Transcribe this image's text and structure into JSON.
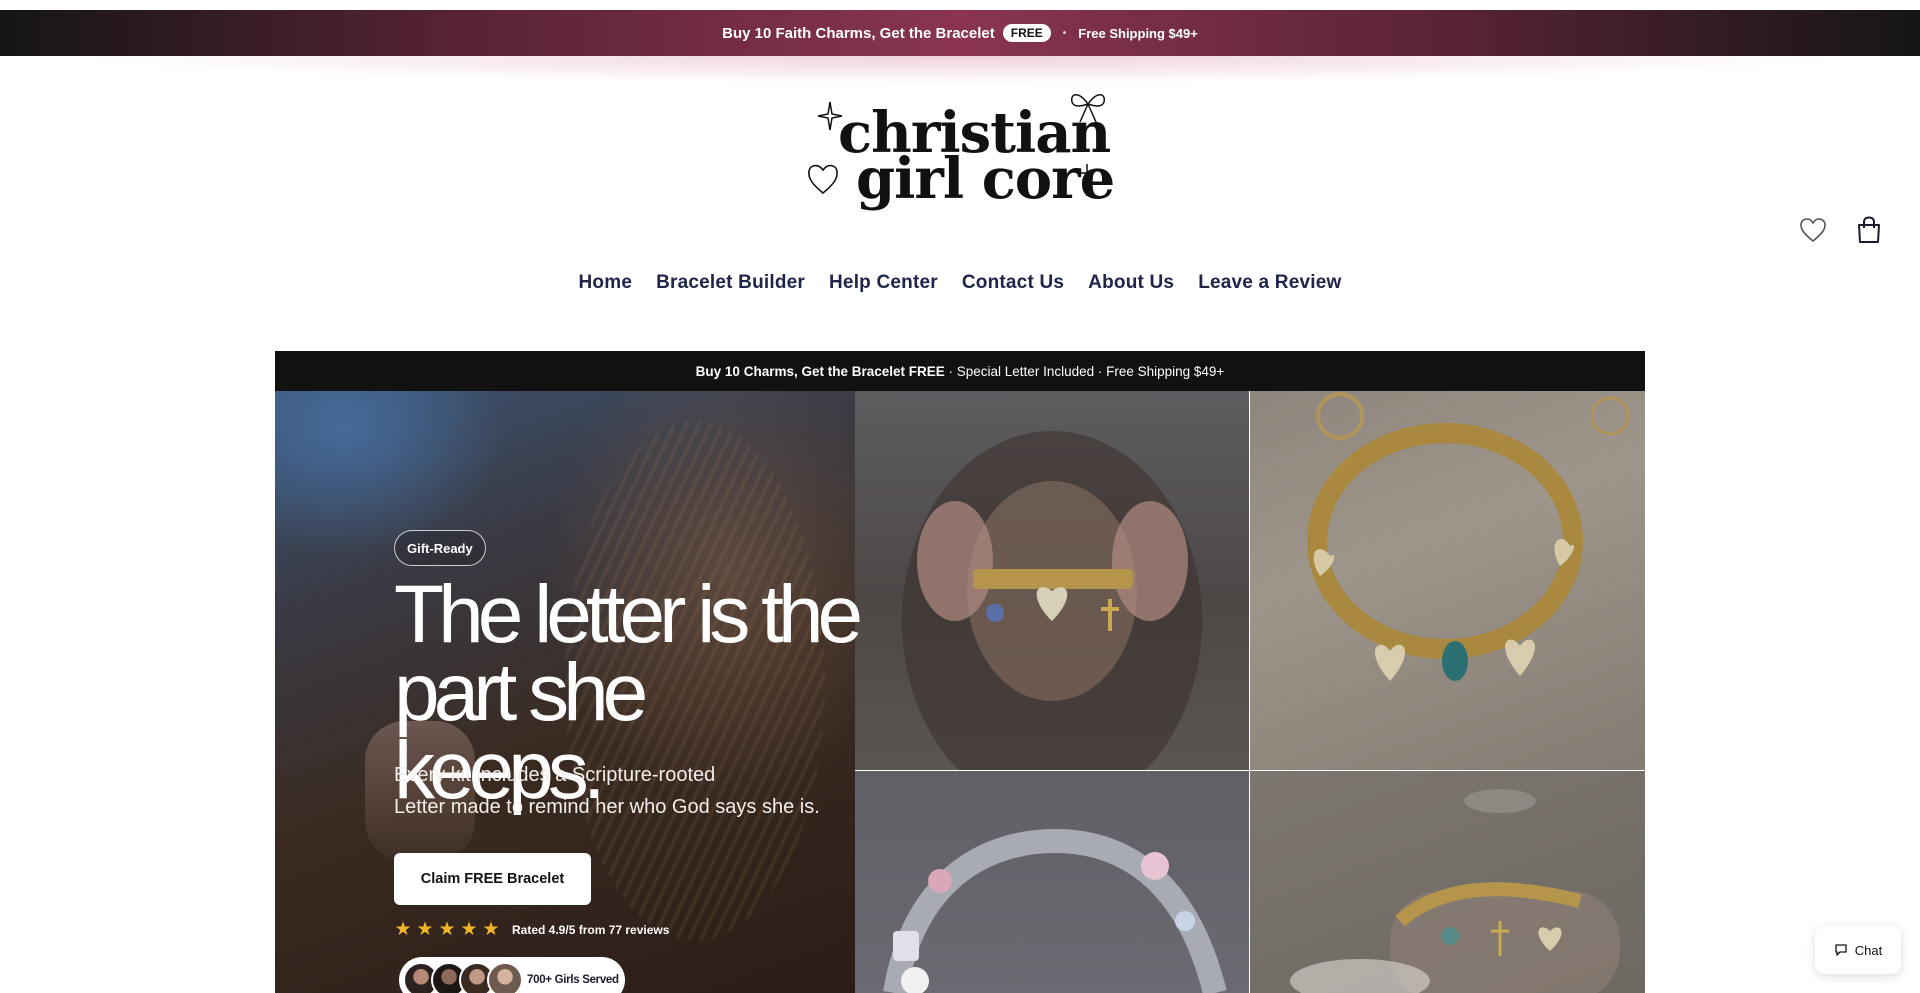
{
  "announcement": {
    "main_text": "Buy 10 Faith Charms, Get the Bracelet",
    "badge": "FREE",
    "separator": "•",
    "shipping": "Free Shipping $49+"
  },
  "logo": {
    "line1": "christian",
    "line2": "girl core"
  },
  "header_icons": {
    "wishlist": "heart-icon",
    "cart": "shopping-bag-icon"
  },
  "nav": {
    "items": [
      {
        "label": "Home"
      },
      {
        "label": "Bracelet Builder"
      },
      {
        "label": "Help Center"
      },
      {
        "label": "Contact Us"
      },
      {
        "label": "About Us"
      },
      {
        "label": "Leave a Review"
      }
    ]
  },
  "hero": {
    "bar": {
      "bold": "Buy 10 Charms, Get the Bracelet FREE",
      "rest": " · Special Letter Included · Free Shipping $49+"
    },
    "badge": "Gift-Ready",
    "headline_line1": "The letter is the",
    "headline_line2": "part she keeps.",
    "sub_line1": "Every kit includes a Scripture-rooted",
    "sub_line2": "Letter made to remind her who God says she is.",
    "cta": "Claim FREE Bracelet",
    "rating_stars": 5,
    "rating_text": "Rated 4.9/5 from 77 reviews",
    "served_text": "700+ Girls Served"
  },
  "chat": {
    "label": "Chat"
  },
  "colors": {
    "announcement": "#8a3550",
    "nav_text": "#20254a",
    "star": "#f0b429",
    "hero_bar": "#111111"
  }
}
